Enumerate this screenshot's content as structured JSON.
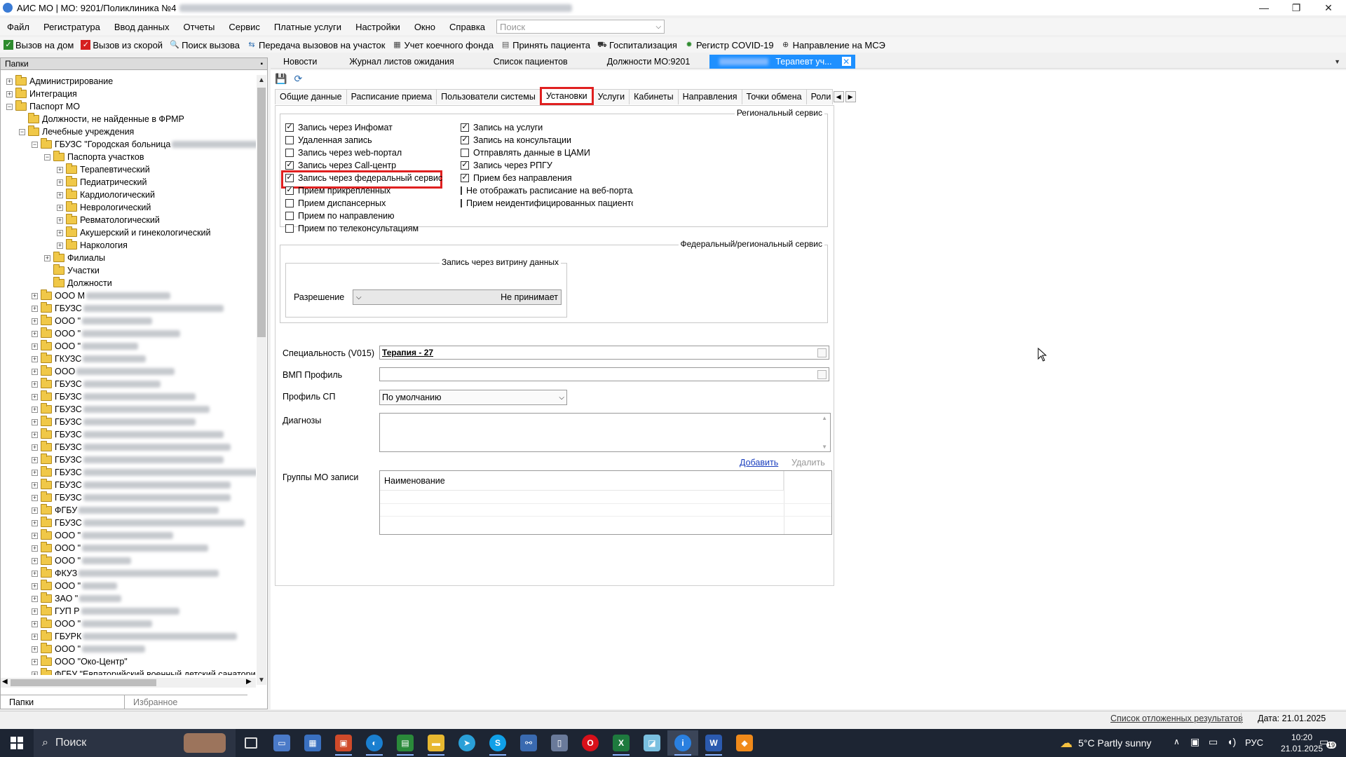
{
  "window": {
    "title": "АИС МО | МО: 9201/Поликлиника №4"
  },
  "menu": [
    "Файл",
    "Регистратура",
    "Ввод данных",
    "Отчеты",
    "Сервис",
    "Платные услуги",
    "Настройки",
    "Окно",
    "Справка"
  ],
  "search": {
    "placeholder": "Поиск"
  },
  "toolbar": [
    {
      "label": "Вызов на дом",
      "icon": "house-call-icon",
      "color": "#2e8b2e"
    },
    {
      "label": "Вызов из скорой",
      "icon": "ambulance-call-icon",
      "color": "#d62020"
    },
    {
      "label": "Поиск вызова",
      "icon": "search-call-icon",
      "color": "#1f4fa8"
    },
    {
      "label": "Передача вызовов на участок",
      "icon": "transfer-call-icon",
      "color": "#2b6cb0"
    },
    {
      "label": "Учет коечного фонда",
      "icon": "bed-fund-icon",
      "color": "#444444"
    },
    {
      "label": "Принять пациента",
      "icon": "accept-patient-icon",
      "color": "#555555"
    },
    {
      "label": "Госпитализация",
      "icon": "hospitalization-icon",
      "color": "#333333"
    },
    {
      "label": "Регистр COVID-19",
      "icon": "covid-register-icon",
      "color": "#2e8b2e"
    },
    {
      "label": "Направление на МСЭ",
      "icon": "mse-referral-icon",
      "color": "#333333"
    }
  ],
  "left_panel": {
    "title": "Папки",
    "pin": "📌",
    "tree_static": [
      {
        "text": "Администрирование",
        "level": 0,
        "exp": "+"
      },
      {
        "text": "Интеграция",
        "level": 0,
        "exp": "+"
      },
      {
        "text": "Паспорт МО",
        "level": 0,
        "exp": "−"
      },
      {
        "text": "Должности, не найденные в ФРМР",
        "level": 1,
        "exp": ""
      },
      {
        "text": "Лечебные учреждения",
        "level": 1,
        "exp": "−"
      },
      {
        "text": "ГБУЗС \"Городская больница",
        "level": 2,
        "exp": "−",
        "blur": 130
      },
      {
        "text": "Паспорта участков",
        "level": 3,
        "exp": "−"
      },
      {
        "text": "Терапевтический",
        "level": 4,
        "exp": "+"
      },
      {
        "text": "Педиатрический",
        "level": 4,
        "exp": "+"
      },
      {
        "text": "Кардиологический",
        "level": 4,
        "exp": "+"
      },
      {
        "text": "Неврологический",
        "level": 4,
        "exp": "+"
      },
      {
        "text": "Ревматологический",
        "level": 4,
        "exp": "+"
      },
      {
        "text": "Акушерский и гинекологический",
        "level": 4,
        "exp": "+"
      },
      {
        "text": "Наркология",
        "level": 4,
        "exp": "+"
      },
      {
        "text": "Филиалы",
        "level": 3,
        "exp": "+"
      },
      {
        "text": "Участки",
        "level": 3,
        "exp": ""
      },
      {
        "text": "Должности",
        "level": 3,
        "exp": "",
        "open": true
      },
      {
        "text": "ООО М",
        "level": 2,
        "exp": "+",
        "blur": 120
      },
      {
        "text": "ГБУЗС",
        "level": 2,
        "exp": "+",
        "blur": 200
      },
      {
        "text": "ООО \"",
        "level": 2,
        "exp": "+",
        "blur": 100
      },
      {
        "text": "ООО \"",
        "level": 2,
        "exp": "+",
        "blur": 140
      },
      {
        "text": "ООО \"",
        "level": 2,
        "exp": "+",
        "blur": 80
      },
      {
        "text": "ГКУЗС",
        "level": 2,
        "exp": "+",
        "blur": 90
      },
      {
        "text": "ООО",
        "level": 2,
        "exp": "+",
        "blur": 140
      },
      {
        "text": "ГБУЗС",
        "level": 2,
        "exp": "+",
        "blur": 110
      },
      {
        "text": "ГБУЗС",
        "level": 2,
        "exp": "+",
        "blur": 160
      },
      {
        "text": "ГБУЗС",
        "level": 2,
        "exp": "+",
        "blur": 180
      },
      {
        "text": "ГБУЗС",
        "level": 2,
        "exp": "+",
        "blur": 160
      },
      {
        "text": "ГБУЗС",
        "level": 2,
        "exp": "+",
        "blur": 200
      },
      {
        "text": "ГБУЗС",
        "level": 2,
        "exp": "+",
        "blur": 210
      },
      {
        "text": "ГБУЗС",
        "level": 2,
        "exp": "+",
        "blur": 200
      },
      {
        "text": "ГБУЗС",
        "level": 2,
        "exp": "+",
        "blur": 250
      },
      {
        "text": "ГБУЗС",
        "level": 2,
        "exp": "+",
        "blur": 210
      },
      {
        "text": "ГБУЗС",
        "level": 2,
        "exp": "+",
        "blur": 210
      },
      {
        "text": "ФГБУ",
        "level": 2,
        "exp": "+",
        "blur": 200
      },
      {
        "text": "ГБУЗС",
        "level": 2,
        "exp": "+",
        "blur": 230
      },
      {
        "text": "ООО \"",
        "level": 2,
        "exp": "+",
        "blur": 130
      },
      {
        "text": "ООО \"",
        "level": 2,
        "exp": "+",
        "blur": 180
      },
      {
        "text": "ООО \"",
        "level": 2,
        "exp": "+",
        "blur": 70
      },
      {
        "text": "ФКУЗ",
        "level": 2,
        "exp": "+",
        "blur": 200
      },
      {
        "text": "ООО \"",
        "level": 2,
        "exp": "+",
        "blur": 50
      },
      {
        "text": "ЗАО \"",
        "level": 2,
        "exp": "+",
        "blur": 60
      },
      {
        "text": "ГУП Р",
        "level": 2,
        "exp": "+",
        "blur": 140
      },
      {
        "text": "ООО \"",
        "level": 2,
        "exp": "+",
        "blur": 100
      },
      {
        "text": "ГБУРК",
        "level": 2,
        "exp": "+",
        "blur": 220
      },
      {
        "text": "ООО \"",
        "level": 2,
        "exp": "+",
        "blur": 90
      },
      {
        "text": "ООО \"Око-Центр\"",
        "level": 2,
        "exp": "+"
      },
      {
        "text": "ФГБУ \"Евпаторийский военный детский санаторий",
        "level": 2,
        "exp": "+"
      }
    ],
    "bottom_tabs": [
      "Папки",
      "Избранное"
    ]
  },
  "doc_tabs": [
    "Новости",
    "Журнал листов ожидания",
    "Список пациентов",
    "Должности МО:9201",
    "Терапевт уч..."
  ],
  "inner_tabs": [
    "Общие данные",
    "Расписание приема",
    "Пользователи системы",
    "Установки",
    "Услуги",
    "Кабинеты",
    "Направления",
    "Точки обмена",
    "Роли с"
  ],
  "regional": {
    "title": "Региональный сервис",
    "left": [
      {
        "label": "Запись через Инфомат",
        "checked": true
      },
      {
        "label": "Удаленная запись",
        "checked": false
      },
      {
        "label": "Запись через web-портал",
        "checked": false
      },
      {
        "label": "Запись через Call-центр",
        "checked": true
      },
      {
        "label": "Запись через федеральный сервис",
        "checked": true
      },
      {
        "label": "Прием прикрепленных",
        "checked": true
      },
      {
        "label": "Прием диспансерных",
        "checked": false
      },
      {
        "label": "Прием по направлению",
        "checked": false
      },
      {
        "label": "Прием по телеконсультациям",
        "checked": false
      }
    ],
    "right": [
      {
        "label": "Запись на услуги",
        "checked": true
      },
      {
        "label": "Запись на консультации",
        "checked": true
      },
      {
        "label": "Отправлять данные в ЦАМИ",
        "checked": false
      },
      {
        "label": "Запись через РПГУ",
        "checked": true
      },
      {
        "label": "Прием без направления",
        "checked": true
      },
      {
        "label": "Не отображать расписание на веб-портал",
        "checked": false
      },
      {
        "label": "Прием неидентифицированных пациенто",
        "checked": false
      }
    ]
  },
  "federal": {
    "title": "Федеральный/региональный сервис",
    "vitrina_title": "Запись через витрину данных",
    "permission_label": "Разрешение",
    "permission_value": "Не принимает"
  },
  "form": {
    "specialty_label": "Специальность (V015)",
    "specialty_value": "Терапия - 27",
    "vmp_label": "ВМП Профиль",
    "vmp_value": "",
    "profile_label": "Профиль СП",
    "profile_value": "По умолчанию",
    "diagnoses_label": "Диагнозы",
    "add_link": "Добавить",
    "delete_link": "Удалить",
    "groups_label": "Группы МО записи",
    "groups_header": "Наименование"
  },
  "statusbar": {
    "deferred": "Список отложенных результатов",
    "date": "Дата: 21.01.2025"
  },
  "taskbar": {
    "search": "Поиск",
    "weather": "5°C  Partly sunny",
    "lang": "РУС",
    "time": "10:20",
    "date": "21.01.2025",
    "notif_count": "19"
  }
}
